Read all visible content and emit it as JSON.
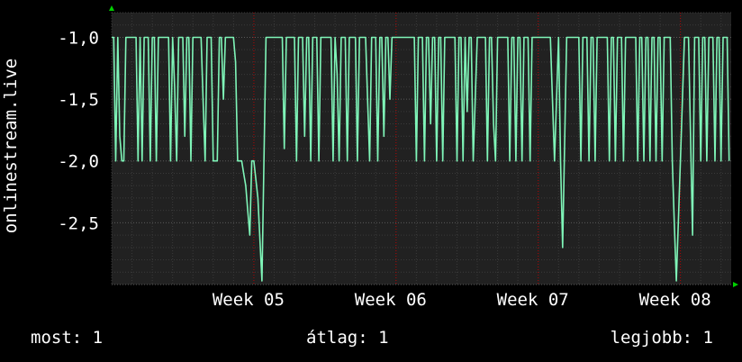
{
  "chart_data": {
    "type": "line",
    "ylabel": "onlinestream.live",
    "ylim": [
      -3.0,
      -0.8
    ],
    "yticks": [
      -1.0,
      -1.5,
      -2.0,
      -2.5
    ],
    "ytick_labels": [
      "-1,0",
      "-1,5",
      "-2,0",
      "-2,5"
    ],
    "xticks": [
      {
        "label": "Week 05",
        "day": 7
      },
      {
        "label": "Week 06",
        "day": 14
      },
      {
        "label": "Week 07",
        "day": 21
      },
      {
        "label": "Week 08",
        "day": 28
      }
    ],
    "xlim_days": [
      0,
      30.5
    ],
    "grid": true,
    "series": [
      {
        "color": "#7ff5b8",
        "x_days": [
          0.0,
          0.1,
          0.2,
          0.3,
          0.4,
          0.5,
          0.6,
          0.7,
          0.8,
          1.0,
          1.2,
          1.3,
          1.4,
          1.5,
          1.6,
          1.7,
          1.8,
          1.9,
          2.0,
          2.1,
          2.2,
          2.3,
          2.4,
          2.6,
          2.8,
          2.9,
          3.0,
          3.1,
          3.2,
          3.3,
          3.4,
          3.5,
          3.6,
          3.7,
          3.8,
          3.9,
          4.0,
          4.2,
          4.4,
          4.5,
          4.6,
          4.7,
          4.8,
          4.9,
          5.0,
          5.1,
          5.2,
          5.3,
          5.4,
          5.5,
          5.6,
          5.8,
          6.0,
          6.1,
          6.2,
          6.3,
          6.4,
          6.5,
          6.6,
          6.7,
          6.8,
          6.9,
          7.0,
          7.2,
          7.4,
          7.6,
          7.8,
          8.0,
          8.2,
          8.4,
          8.5,
          8.6,
          8.8,
          9.0,
          9.1,
          9.2,
          9.3,
          9.4,
          9.5,
          9.6,
          9.7,
          9.8,
          9.9,
          10.0,
          10.1,
          10.2,
          10.3,
          10.4,
          10.6,
          10.8,
          10.9,
          11.0,
          11.1,
          11.2,
          11.3,
          11.4,
          11.5,
          11.6,
          11.7,
          11.8,
          11.9,
          12.0,
          12.1,
          12.2,
          12.4,
          12.5,
          12.6,
          12.7,
          12.8,
          12.9,
          13.0,
          13.1,
          13.2,
          13.3,
          13.4,
          13.5,
          13.6,
          13.7,
          13.8,
          14.0,
          14.2,
          14.4,
          14.6,
          14.8,
          14.9,
          15.0,
          15.1,
          15.2,
          15.3,
          15.4,
          15.5,
          15.6,
          15.7,
          15.8,
          15.9,
          16.0,
          16.1,
          16.2,
          16.3,
          16.4,
          16.6,
          16.8,
          16.9,
          17.0,
          17.1,
          17.2,
          17.3,
          17.4,
          17.5,
          17.6,
          17.7,
          17.8,
          18.0,
          18.2,
          18.3,
          18.4,
          18.5,
          18.6,
          18.7,
          18.8,
          18.9,
          19.0,
          19.2,
          19.4,
          19.5,
          19.6,
          19.7,
          19.8,
          19.9,
          20.0,
          20.1,
          20.2,
          20.3,
          20.4,
          20.5,
          20.6,
          20.7,
          20.8,
          21.0,
          21.2,
          21.4,
          21.6,
          21.8,
          22.0,
          22.1,
          22.2,
          22.4,
          22.6,
          22.8,
          22.9,
          23.0,
          23.1,
          23.2,
          23.3,
          23.4,
          23.5,
          23.6,
          23.7,
          23.8,
          23.9,
          24.0,
          24.2,
          24.3,
          24.4,
          24.5,
          24.6,
          24.7,
          24.8,
          24.9,
          25.0,
          25.1,
          25.2,
          25.3,
          25.4,
          25.6,
          25.8,
          25.9,
          26.0,
          26.1,
          26.2,
          26.3,
          26.4,
          26.5,
          26.6,
          26.7,
          26.8,
          26.9,
          27.0,
          27.1,
          27.2,
          27.3,
          27.4,
          27.5,
          27.6,
          27.7,
          27.8,
          28.0,
          28.2,
          28.4,
          28.6,
          28.7,
          28.8,
          28.9,
          29.0,
          29.1,
          29.2,
          29.3,
          29.4,
          29.5,
          29.6,
          29.7,
          29.8,
          29.9,
          30.0,
          30.1,
          30.2,
          30.3,
          30.4
        ],
        "y": [
          -1.0,
          -1.0,
          -2.0,
          -1.0,
          -1.8,
          -2.0,
          -2.0,
          -1.0,
          -1.0,
          -1.0,
          -1.0,
          -2.0,
          -1.0,
          -2.0,
          -1.0,
          -1.0,
          -1.0,
          -2.0,
          -1.0,
          -1.0,
          -2.0,
          -1.0,
          -1.0,
          -1.0,
          -1.0,
          -2.0,
          -1.0,
          -1.4,
          -2.0,
          -1.0,
          -1.0,
          -1.0,
          -1.8,
          -1.0,
          -1.0,
          -2.0,
          -1.0,
          -1.0,
          -1.0,
          -1.5,
          -2.0,
          -1.0,
          -1.0,
          -1.0,
          -2.0,
          -2.0,
          -2.0,
          -1.0,
          -1.0,
          -1.5,
          -1.0,
          -1.0,
          -1.0,
          -1.2,
          -2.0,
          -2.0,
          -2.0,
          -2.1,
          -2.2,
          -2.4,
          -2.6,
          -2.0,
          -2.0,
          -2.3,
          -2.97,
          -1.0,
          -1.0,
          -1.0,
          -1.0,
          -1.0,
          -1.9,
          -1.0,
          -1.0,
          -1.0,
          -2.0,
          -1.0,
          -1.0,
          -1.0,
          -1.8,
          -1.0,
          -1.0,
          -2.0,
          -1.0,
          -1.0,
          -1.0,
          -2.0,
          -1.0,
          -1.0,
          -1.0,
          -1.0,
          -2.0,
          -1.0,
          -1.3,
          -2.0,
          -1.0,
          -1.0,
          -1.0,
          -2.0,
          -1.0,
          -1.0,
          -1.0,
          -1.0,
          -2.0,
          -1.0,
          -1.0,
          -1.0,
          -1.5,
          -2.0,
          -1.0,
          -1.0,
          -1.0,
          -2.0,
          -1.0,
          -1.0,
          -1.8,
          -1.0,
          -1.0,
          -1.5,
          -1.0,
          -1.0,
          -1.0,
          -1.0,
          -1.0,
          -1.0,
          -1.0,
          -2.0,
          -1.0,
          -1.0,
          -1.0,
          -2.0,
          -1.0,
          -1.0,
          -1.7,
          -1.0,
          -1.0,
          -2.0,
          -1.0,
          -1.0,
          -2.0,
          -1.0,
          -1.0,
          -1.0,
          -1.0,
          -2.0,
          -1.0,
          -1.0,
          -2.0,
          -1.0,
          -1.6,
          -1.0,
          -1.0,
          -2.0,
          -1.0,
          -1.0,
          -1.0,
          -1.0,
          -2.0,
          -1.0,
          -1.0,
          -1.7,
          -2.0,
          -1.0,
          -1.0,
          -1.0,
          -1.0,
          -2.0,
          -1.0,
          -1.0,
          -2.0,
          -1.0,
          -1.0,
          -2.0,
          -1.0,
          -1.0,
          -1.0,
          -2.0,
          -1.0,
          -1.0,
          -1.0,
          -1.0,
          -1.0,
          -1.0,
          -2.0,
          -1.0,
          -2.0,
          -2.7,
          -1.0,
          -1.0,
          -1.0,
          -1.0,
          -1.0,
          -2.0,
          -1.0,
          -1.0,
          -1.0,
          -2.0,
          -1.0,
          -1.0,
          -2.0,
          -1.0,
          -1.0,
          -1.0,
          -1.0,
          -1.0,
          -2.0,
          -1.0,
          -1.0,
          -2.0,
          -1.0,
          -1.0,
          -1.0,
          -2.0,
          -1.0,
          -1.0,
          -1.0,
          -1.0,
          -2.0,
          -1.0,
          -1.0,
          -2.0,
          -1.0,
          -1.0,
          -2.0,
          -1.0,
          -1.0,
          -2.0,
          -1.0,
          -1.0,
          -2.0,
          -1.0,
          -1.0,
          -1.0,
          -1.0,
          -2.0,
          -2.5,
          -2.97,
          -2.0,
          -1.0,
          -1.0,
          -2.6,
          -1.0,
          -1.0,
          -1.0,
          -2.0,
          -1.0,
          -1.0,
          -2.0,
          -1.0,
          -1.0,
          -1.0,
          -2.0,
          -1.0,
          -1.0,
          -2.0,
          -1.0,
          -1.0,
          -1.0,
          -2.0
        ]
      }
    ]
  },
  "legend": {
    "now": "most: 1",
    "avg": "átlag: 1",
    "max": "legjobb: 1"
  },
  "colors": {
    "background": "#000000",
    "plot_background": "#212121",
    "grid_minor": "#3a3a3a",
    "grid_major": "#5a5a5a",
    "week_line": "#b00000",
    "axis_arrow": "#00d000",
    "text": "#ffffff"
  }
}
